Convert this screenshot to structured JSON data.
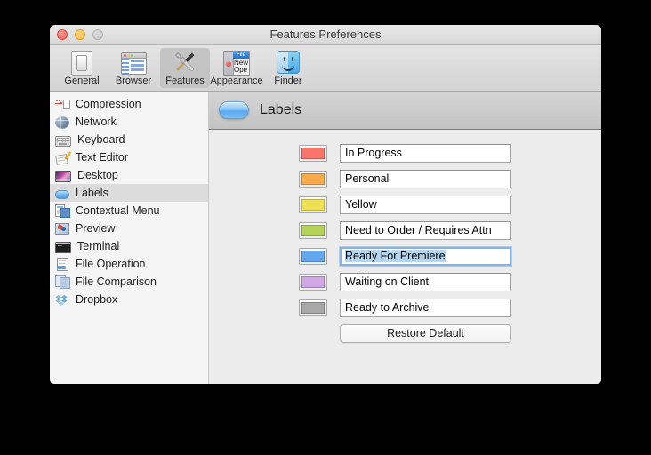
{
  "window": {
    "title": "Features Preferences",
    "controls": {
      "close": "close",
      "minimize": "minimize",
      "zoom": "zoom"
    }
  },
  "toolbar": {
    "items": [
      {
        "label": "General",
        "icon": "general-switch-icon",
        "selected": false
      },
      {
        "label": "Browser",
        "icon": "browser-window-icon",
        "selected": false
      },
      {
        "label": "Features",
        "icon": "tools-icon",
        "selected": true
      },
      {
        "label": "Appearance",
        "icon": "new-file-icon",
        "selected": false
      },
      {
        "label": "Finder",
        "icon": "finder-face-icon",
        "selected": false
      }
    ]
  },
  "sidebar": {
    "items": [
      {
        "label": "Compression",
        "icon": "compression-icon",
        "selected": false
      },
      {
        "label": "Network",
        "icon": "globe-icon",
        "selected": false
      },
      {
        "label": "Keyboard",
        "icon": "keyboard-icon",
        "selected": false
      },
      {
        "label": "Text Editor",
        "icon": "text-editor-icon",
        "selected": false
      },
      {
        "label": "Desktop",
        "icon": "desktop-icon",
        "selected": false
      },
      {
        "label": "Labels",
        "icon": "label-pill-icon",
        "selected": true
      },
      {
        "label": "Contextual Menu",
        "icon": "contextual-menu-icon",
        "selected": false
      },
      {
        "label": "Preview",
        "icon": "preview-icon",
        "selected": false
      },
      {
        "label": "Terminal",
        "icon": "terminal-icon",
        "selected": false
      },
      {
        "label": "File Operation",
        "icon": "file-operation-icon",
        "selected": false
      },
      {
        "label": "File Comparison",
        "icon": "file-comparison-icon",
        "selected": false
      },
      {
        "label": "Dropbox",
        "icon": "dropbox-icon",
        "selected": false
      }
    ]
  },
  "content": {
    "header": {
      "title": "Labels",
      "badge_icon": "label-pill-icon",
      "badge_color": "#6fb6f2"
    },
    "labels": [
      {
        "color": "#f9756a",
        "name": "In Progress",
        "focused": false,
        "selected_text": false
      },
      {
        "color": "#f6ab4b",
        "name": "Personal",
        "focused": false,
        "selected_text": false
      },
      {
        "color": "#f0e154",
        "name": "Yellow",
        "focused": false,
        "selected_text": false
      },
      {
        "color": "#b6d257",
        "name": "Need to Order / Requires Attn",
        "focused": false,
        "selected_text": false
      },
      {
        "color": "#64a9f0",
        "name": "Ready For Premiere",
        "focused": true,
        "selected_text": true
      },
      {
        "color": "#d0a7e4",
        "name": "Waiting on Client",
        "focused": false,
        "selected_text": false
      },
      {
        "color": "#a8a8a8",
        "name": "Ready to Archive",
        "focused": false,
        "selected_text": false
      }
    ],
    "restore_button": "Restore Default"
  }
}
